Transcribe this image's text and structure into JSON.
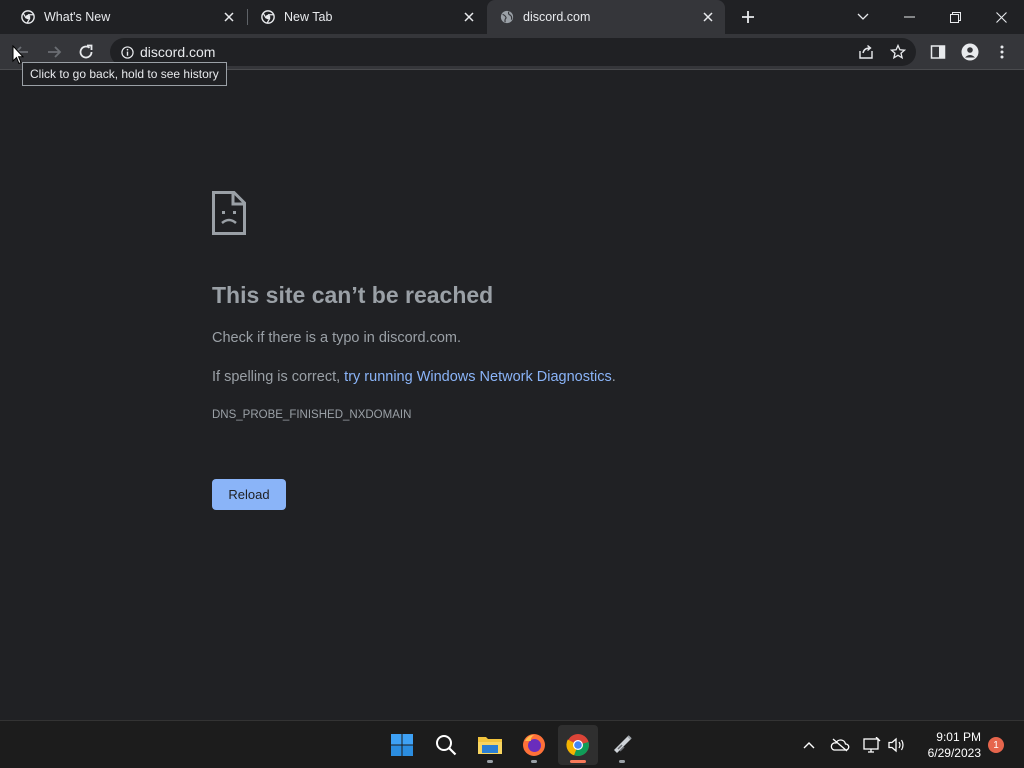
{
  "browser": {
    "tabs": [
      {
        "title": "What's New",
        "active": false
      },
      {
        "title": "New Tab",
        "active": false
      },
      {
        "title": "discord.com",
        "active": true
      }
    ],
    "address": "discord.com",
    "tooltip": "Click to go back, hold to see history"
  },
  "error_page": {
    "title": "This site can’t be reached",
    "line1": "Check if there is a typo in discord.com.",
    "line2_prefix": "If spelling is correct, ",
    "line2_link": "try running Windows Network Diagnostics",
    "line2_suffix": ".",
    "error_code": "DNS_PROBE_FINISHED_NXDOMAIN",
    "reload_label": "Reload"
  },
  "taskbar": {
    "time": "9:01 PM",
    "date": "6/29/2023",
    "notification_count": "1"
  },
  "colors": {
    "link": "#8ab4f8",
    "button": "#8ab4f8",
    "page_bg": "#202124",
    "notification_badge": "#e6654c"
  }
}
